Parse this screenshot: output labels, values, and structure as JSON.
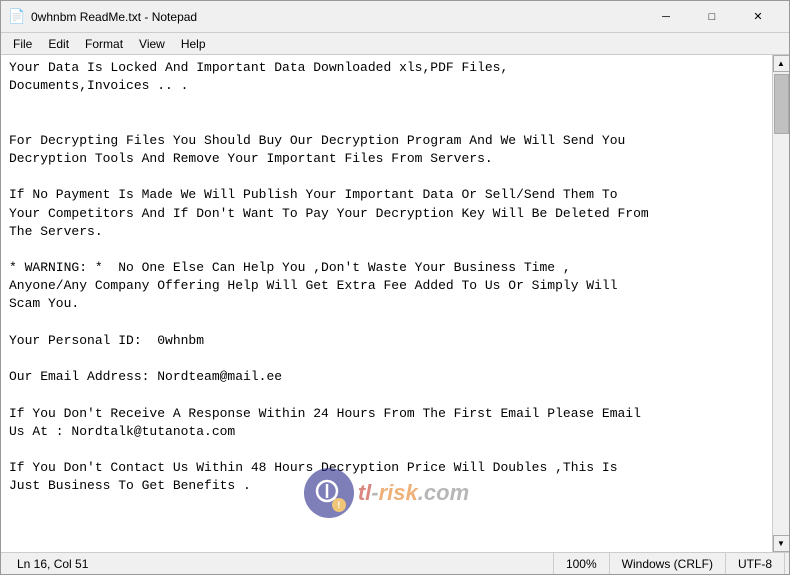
{
  "window": {
    "title": "0whnbm ReadMe.txt - Notepad",
    "icon": "📄"
  },
  "title_buttons": {
    "minimize": "─",
    "maximize": "□",
    "close": "✕"
  },
  "menu": {
    "items": [
      "File",
      "Edit",
      "Format",
      "View",
      "Help"
    ]
  },
  "content": {
    "text": "Your Data Is Locked And Important Data Downloaded xls,PDF Files,\nDocuments,Invoices .. .\n\n\nFor Decrypting Files You Should Buy Our Decryption Program And We Will Send You\nDecryption Tools And Remove Your Important Files From Servers.\n\nIf No Payment Is Made We Will Publish Your Important Data Or Sell/Send Them To\nYour Competitors And If Don't Want To Pay Your Decryption Key Will Be Deleted From\nThe Servers.\n\n* WARNING: *  No One Else Can Help You ,Don't Waste Your Business Time ,\nAnyone/Any Company Offering Help Will Get Extra Fee Added To Us Or Simply Will\nScam You.\n\nYour Personal ID:  0whnbm\n\nOur Email Address: Nordteam@mail.ee\n\nIf You Don't Receive A Response Within 24 Hours From The First Email Please Email\nUs At : Nordtalk@tutanota.com\n\nIf You Don't Contact Us Within 48 Hours Decryption Price Will Doubles ,This Is\nJust Business To Get Benefits ."
  },
  "status_bar": {
    "position": "Ln 16, Col 51",
    "zoom": "100%",
    "line_ending": "Windows (CRLF)",
    "encoding": "UTF-8"
  },
  "watermark": {
    "site": "tl-risk.com",
    "parts": {
      "tl": "tl",
      "dash": "-",
      "risk": "risk",
      "dot_com": ".com"
    }
  }
}
